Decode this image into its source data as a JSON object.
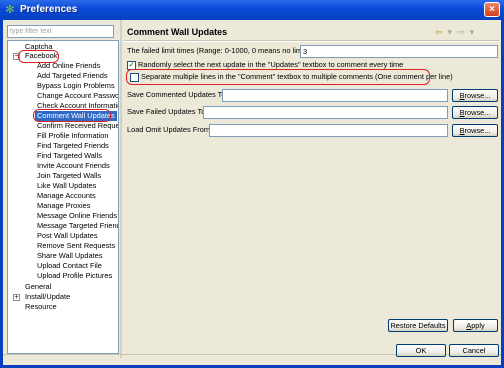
{
  "window": {
    "title": "Preferences",
    "close": "×"
  },
  "filter": {
    "placeholder": "type filter text"
  },
  "tree": {
    "captcha": "Captcha",
    "facebook": "Facebook",
    "facebook_expander": "−",
    "children": [
      "Add Online Friends",
      "Add Targeted Friends",
      "Bypass Login Problems",
      "Change Account Passwor",
      "Check Account Informatio",
      "Comment Wall Updates",
      "Confirm Received Reques",
      "Fill Profile Information",
      "Find Targeted Friends",
      "Find Targeted Walls",
      "Invite Account Friends",
      "Join Targeted Walls",
      "Like Wall Updates",
      "Manage Accounts",
      "Manage Proxies",
      "Message Online Friends",
      "Message Targeted Friends",
      "Post Wall Updates",
      "Remove Sent Requests",
      "Share Wall Updates",
      "Upload Contact File",
      "Upload Profile Pictures"
    ],
    "general": "General",
    "install_update": "Install/Update",
    "install_expander": "+",
    "resource": "Resource"
  },
  "page": {
    "title": "Comment Wall Updates",
    "nav_icons": [
      "back-arrow-icon",
      "menu-dropdown-icon",
      "forward-arrow-icon",
      "view-menu-icon"
    ],
    "failed_limit_label": "The failed limit times (Range: 0-1000, 0 means no limit)",
    "failed_limit_value": "3",
    "random_select_label": "Randomly select the next update in the \"Updates\" textbox to comment every time",
    "random_select_checked": true,
    "separate_lines_label": "Separate multiple lines in the \"Comment\" textbox to multiple comments (One comment per line)",
    "separate_lines_checked": false,
    "save_commented_label": "Save Commented Updates To",
    "save_commented_value": "",
    "save_failed_label": "Save Failed Updates To",
    "save_failed_value": "",
    "load_omit_label": "Load Omit Updates From",
    "load_omit_value": "",
    "browse": "Browse...",
    "restore_defaults": "Restore Defaults",
    "apply": "Apply"
  },
  "footer": {
    "ok": "OK",
    "cancel": "Cancel"
  },
  "colors": {
    "selection": "#316ac5",
    "highlight_ring": "#dd2222",
    "titlebar": "#0a49d6"
  }
}
